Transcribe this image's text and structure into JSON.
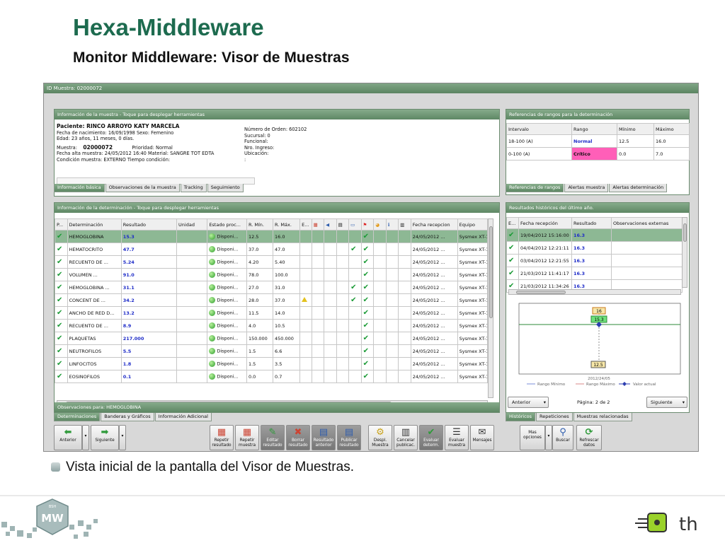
{
  "slide": {
    "title": "Hexa-Middleware",
    "subtitle": "Monitor Middleware: Visor de Muestras",
    "caption": "Vista inicial de la pantalla del Visor de Muestras.",
    "logo_left": "MW",
    "logo_left_top": "BSH",
    "logo_right": "th"
  },
  "app": {
    "id_bar": "ID Muestra: 02000072",
    "sample_panel": {
      "header": "Información de la muestra - Toque para desplegar herramientas",
      "left_lines": [
        "Paciente:  RINCO ARROYO KATY MARCELA",
        "Fecha de nacimiento: 16/09/1998    Sexo: Femenino",
        "Edad: 23 años, 11 meses, 0 días."
      ],
      "muestra_label": "Muestra:",
      "muestra_value": "02000072",
      "prioridad": "Prioridad: Normal",
      "left_lines2": [
        "Fecha alta muestra: 24/05/2012 16:40   Material:  SANGRE TOT EDTA",
        "Condición muestra: EXTERNO             Tiempo condición:"
      ],
      "right_lines": [
        "Número de Orden:  602102",
        "Sucursal:  0",
        "Funcional:",
        "Nro. Ingreso:",
        "Ubicación:",
        ":"
      ],
      "tabs": [
        "Información básica",
        "Observaciones de la muestra",
        "Tracking",
        "Seguimiento"
      ]
    },
    "ranges_panel": {
      "header": "Referencias de rangos para la determinación",
      "columns": [
        "Intervalo",
        "Rango",
        "Mínimo",
        "Máximo"
      ],
      "rows": [
        [
          "18-100 (A)",
          "Normal",
          "12.5",
          "16.0"
        ],
        [
          "0-100 (A)",
          "Crítico",
          "0.0",
          "7.0"
        ]
      ],
      "normal_color": "#1f2dc8",
      "critico_bg": "#ff5fb8",
      "tabs": [
        "Referencias de rangos",
        "Alertas muestra",
        "Alertas determinación"
      ]
    },
    "det_panel": {
      "header": "Información de la determinación - Toque para desplegar herramientas",
      "columns": [
        "P...",
        "Determinación",
        "Resultado",
        "Unidad",
        "Estado proc...",
        "R. Mín.",
        "R. Máx.",
        "E..."
      ],
      "columns_tail": [
        "Fecha recepcion",
        "Equipo"
      ],
      "rows": [
        {
          "det": "HEMOGLOBINA",
          "res": "15.3",
          "estado": "Disponi...",
          "min": "12.5",
          "max": "16.0",
          "warn": false,
          "c1": false,
          "c2": true,
          "fecha": "24/05/2012 ...",
          "equipo": "Sysmex XT-1800"
        },
        {
          "det": "HEMATOCRITO",
          "res": "47.7",
          "estado": "Disponi...",
          "min": "37.0",
          "max": "47.0",
          "warn": false,
          "c1": true,
          "c2": true,
          "fecha": "24/05/2012 ...",
          "equipo": "Sysmex XT-1800"
        },
        {
          "det": "RECUENTO DE ...",
          "res": "5.24",
          "estado": "Disponi...",
          "min": "4.20",
          "max": "5.40",
          "warn": false,
          "c1": false,
          "c2": true,
          "fecha": "24/05/2012 ...",
          "equipo": "Sysmex XT-1800"
        },
        {
          "det": "VOLUMEN ...",
          "res": "91.0",
          "estado": "Disponi...",
          "min": "78.0",
          "max": "100.0",
          "warn": false,
          "c1": false,
          "c2": true,
          "fecha": "24/05/2012 ...",
          "equipo": "Sysmex XT-1800"
        },
        {
          "det": "HEMOGLOBINA ...",
          "res": "31.1",
          "estado": "Disponi...",
          "min": "27.0",
          "max": "31.0",
          "warn": false,
          "c1": true,
          "c2": true,
          "fecha": "24/05/2012 ...",
          "equipo": "Sysmex XT-1800"
        },
        {
          "det": "CONCENT DE ...",
          "res": "34.2",
          "estado": "Disponi...",
          "min": "28.0",
          "max": "37.0",
          "warn": true,
          "c1": true,
          "c2": true,
          "fecha": "24/05/2012 ...",
          "equipo": "Sysmex XT-1800"
        },
        {
          "det": "ANCHO DE RED D...",
          "res": "13.2",
          "estado": "Disponi...",
          "min": "11.5",
          "max": "14.0",
          "warn": false,
          "c1": false,
          "c2": true,
          "fecha": "24/05/2012 ...",
          "equipo": "Sysmex XT-1800"
        },
        {
          "det": "RECUENTO DE ...",
          "res": "8.9",
          "estado": "Disponi...",
          "min": "4.0",
          "max": "10.5",
          "warn": false,
          "c1": false,
          "c2": true,
          "fecha": "24/05/2012 ...",
          "equipo": "Sysmex XT-1800"
        },
        {
          "det": "PLAQUETAS",
          "res": "217.000",
          "estado": "Disponi...",
          "min": "150.000",
          "max": "450.000",
          "warn": false,
          "c1": false,
          "c2": true,
          "fecha": "24/05/2012 ...",
          "equipo": "Sysmex XT-1800"
        },
        {
          "det": "NEUTROFILOS",
          "res": "5.5",
          "estado": "Disponi...",
          "min": "1.5",
          "max": "6.6",
          "warn": false,
          "c1": false,
          "c2": true,
          "fecha": "24/05/2012 ...",
          "equipo": "Sysmex XT-1800"
        },
        {
          "det": "LINFOCITOS",
          "res": "1.8",
          "estado": "Disponi...",
          "min": "1.5",
          "max": "3.5",
          "warn": false,
          "c1": false,
          "c2": true,
          "fecha": "24/05/2012 ...",
          "equipo": "Sysmex XT-1800"
        },
        {
          "det": "EOSINOFILOS",
          "res": "0.1",
          "estado": "Disponi...",
          "min": "0.0",
          "max": "0.7",
          "warn": false,
          "c1": false,
          "c2": true,
          "fecha": "24/05/2012 ...",
          "equipo": "Sysmex XT-1800"
        }
      ],
      "obs": "Observaciones para: HEMOGLOBINA",
      "tabs": [
        "Determinaciones",
        "Banderas y Gráficos",
        "Información Adicional"
      ]
    },
    "hist_panel": {
      "header": "Resultados históricos del último año.",
      "columns": [
        "E...",
        "Fecha recepción",
        "Resultado",
        "Observaciones externas"
      ],
      "rows": [
        [
          "19/04/2012 15:16:00",
          "16.3"
        ],
        [
          "04/04/2012 12:21:11",
          "16.3"
        ],
        [
          "03/04/2012 12:21:55",
          "16.3"
        ],
        [
          "21/03/2012 11:41:17",
          "16.3"
        ],
        [
          "21/03/2012 11:34:26",
          "16.3"
        ]
      ],
      "chart": {
        "max_box": "16",
        "val_box": "15.3",
        "min_box": "12.5",
        "date": "2012/24/05",
        "legend": [
          "Rango Mínimo",
          "Rango Máximo",
          "Valor actual"
        ]
      },
      "prev": "Anterior",
      "page": "Página: 2 de 2",
      "next": "Siguiente",
      "tabs": [
        "Históricos",
        "Repeticiones",
        "Muestras relacionadas"
      ]
    },
    "toolbar": {
      "anterior": "Anterior",
      "siguiente": "Siguiente",
      "buttons": [
        {
          "l1": "Repetir",
          "l2": "resultado",
          "dis": false,
          "c": "r",
          "g": "▦"
        },
        {
          "l1": "Repetir",
          "l2": "muestra",
          "dis": false,
          "c": "r",
          "g": "▦"
        },
        {
          "l1": "Editar",
          "l2": "resultado",
          "dis": true,
          "c": "g",
          "g": "✎"
        },
        {
          "l1": "Borrar",
          "l2": "resultado",
          "dis": true,
          "c": "r",
          "g": "✖"
        },
        {
          "l1": "Resultado",
          "l2": "anterior",
          "dis": true,
          "c": "b",
          "g": "▤"
        },
        {
          "l1": "Publicar",
          "l2": "resultado",
          "dis": true,
          "c": "b",
          "g": "▤"
        },
        {
          "l1": "Despl.",
          "l2": "Muestra",
          "dis": false,
          "c": "y",
          "g": "⚙"
        },
        {
          "l1": "Cancelar",
          "l2": "publicac.",
          "dis": false,
          "c": "k",
          "g": "▥"
        },
        {
          "l1": "Evaluar",
          "l2": "determ.",
          "dis": true,
          "c": "g",
          "g": "✔"
        },
        {
          "l1": "Evaluar",
          "l2": "muestra",
          "dis": false,
          "c": "k",
          "g": "☰"
        },
        {
          "l1": "Mensajes",
          "l2": "",
          "dis": false,
          "c": "k",
          "g": "✉"
        }
      ],
      "mas": "Mas opciones",
      "buscar": "Buscar",
      "refrescar1": "Refrescar",
      "refrescar2": "datos"
    }
  }
}
